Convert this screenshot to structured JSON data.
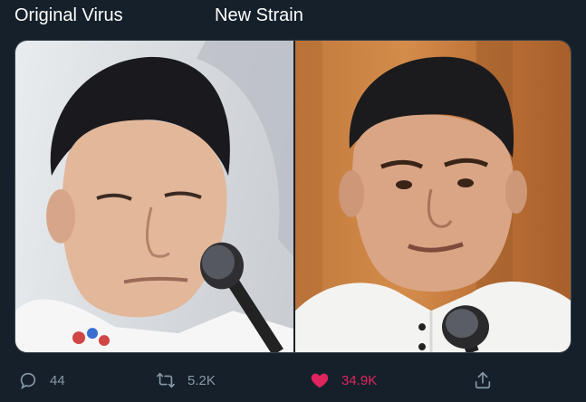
{
  "tweet": {
    "captions": {
      "left": "Original Virus",
      "right": "New Strain"
    },
    "actions": {
      "reply": {
        "icon": "reply-icon",
        "count": "44"
      },
      "retweet": {
        "icon": "retweet-icon",
        "count": "5.2K"
      },
      "like": {
        "icon": "heart-icon",
        "count": "34.9K",
        "liked": true,
        "color": "#e0245e"
      },
      "share": {
        "icon": "share-icon"
      }
    }
  },
  "colors": {
    "background": "#15202b",
    "text": "#ffffff",
    "muted": "#8899a6",
    "like": "#e0245e"
  }
}
